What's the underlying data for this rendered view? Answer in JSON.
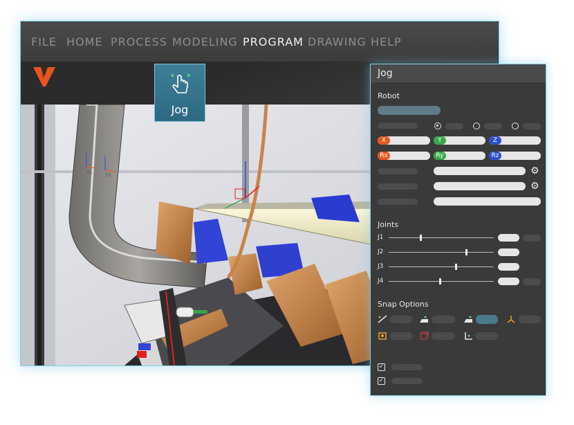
{
  "menu": {
    "items": [
      {
        "label": "FILE"
      },
      {
        "label": "HOME"
      },
      {
        "label": "PROCESS"
      },
      {
        "label": "MODELING"
      },
      {
        "label": "PROGRAM"
      },
      {
        "label": "DRAWING"
      },
      {
        "label": "HELP"
      }
    ],
    "active": "PROGRAM"
  },
  "ribbon": {
    "jog_button_label": "Jog",
    "jog_icon": "hand-pointer-icon"
  },
  "viewport": {
    "frame_labels": [
      "P1",
      "P2"
    ]
  },
  "panel": {
    "title": "Jog",
    "robot": {
      "section_label": "Robot",
      "axes": [
        "X",
        "Y",
        "Z",
        "Rx",
        "Ry",
        "Rz"
      ],
      "radio_selected_index": 0
    },
    "joints": {
      "section_label": "Joints",
      "rows": [
        {
          "label": "J1",
          "level": 0.3
        },
        {
          "label": "J2",
          "level": 0.74
        },
        {
          "label": "J3",
          "level": 0.64
        },
        {
          "label": "J4",
          "level": 0.49
        }
      ]
    },
    "snap": {
      "section_label": "Snap Options",
      "icons": [
        "snap-line-icon",
        "snap-surface-icon",
        "snap-face-icon",
        "snap-vertex-icon",
        "snap-frame-icon",
        "snap-box-icon",
        "snap-edge-icon"
      ]
    },
    "checkboxes_checked": [
      true,
      true
    ]
  },
  "colors": {
    "accent": "#3f7f99",
    "logo": "#e8561d",
    "axis_x": "#e8561d",
    "axis_y": "#3aa64a",
    "axis_z": "#2d4fd1"
  }
}
